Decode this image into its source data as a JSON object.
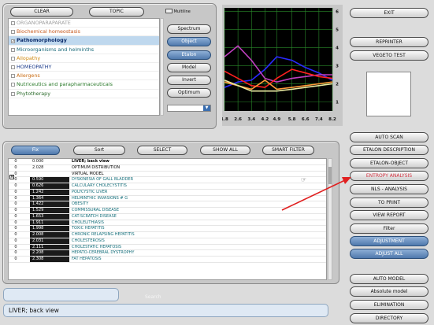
{
  "top_panel": {
    "clear_label": "CLEAR",
    "topic_label": "TOPIC",
    "multiline_label": "Multiline",
    "categories": [
      {
        "label": "ORGANOPARAPARATE",
        "color": "#a0a0a0",
        "checked": false,
        "selected": false
      },
      {
        "label": "Biochemical homeostasis",
        "color": "#c75a1e",
        "checked": false,
        "selected": false
      },
      {
        "label": "Pathomorphology",
        "color": "#0b2b6b",
        "checked": true,
        "selected": true
      },
      {
        "label": "Microorganisms and helminths",
        "color": "#1a6a7a",
        "checked": false,
        "selected": false
      },
      {
        "label": "Allopathy",
        "color": "#d08a10",
        "checked": false,
        "selected": false
      },
      {
        "label": "HOMEOPATHY",
        "color": "#1a3a8a",
        "checked": false,
        "selected": false
      },
      {
        "label": "Allergens",
        "color": "#c86a10",
        "checked": false,
        "selected": false
      },
      {
        "label": "Nutriceutics and parapharmaceuticals",
        "color": "#2a7a2a",
        "checked": false,
        "selected": false
      },
      {
        "label": "Phytotherapy",
        "color": "#2a6a2a",
        "checked": false,
        "selected": false
      }
    ],
    "mode_buttons": {
      "spectrum": "Spectrum",
      "object": "Object",
      "etalon": "Etalon",
      "model": "Model",
      "invert": "Invert",
      "optimum": "Optimum"
    }
  },
  "chart_data": {
    "type": "line",
    "x": [
      1.8,
      2.6,
      3.4,
      4.2,
      4.9,
      5.8,
      6.6,
      7.4,
      8.2
    ],
    "xtick_labels": [
      "1.8",
      "2.6",
      "3.4",
      "4.2",
      "4.9",
      "5.8",
      "6.6",
      "7.4",
      "8.2"
    ],
    "ytick_labels": [
      "1",
      "2",
      "3",
      "4",
      "5",
      "6"
    ],
    "ylim": [
      0.5,
      6.2
    ],
    "series": [
      {
        "color": "#2a2aff",
        "values": [
          1.8,
          2.1,
          2.2,
          2.8,
          3.5,
          3.3,
          2.9,
          2.6,
          2.2
        ]
      },
      {
        "color": "#c040c0",
        "values": [
          3.5,
          4.1,
          3.3,
          2.3,
          2.1,
          2.3,
          2.4,
          2.5,
          2.5
        ]
      },
      {
        "color": "#ff2020",
        "values": [
          2.7,
          2.3,
          1.9,
          1.8,
          2.3,
          2.8,
          2.6,
          2.4,
          2.3
        ]
      },
      {
        "color": "#ff9a3a",
        "values": [
          2.1,
          1.9,
          1.7,
          2.2,
          1.7,
          1.8,
          1.9,
          2.0,
          2.1
        ]
      },
      {
        "color": "#e8e8a0",
        "values": [
          2.2,
          1.9,
          1.6,
          1.6,
          1.6,
          1.7,
          1.8,
          1.9,
          2.0
        ]
      }
    ]
  },
  "right_top": {
    "exit": "EXIT",
    "reprinter": "REPRINTER",
    "vegeto_test": "VEGETO TEST"
  },
  "toolbar": {
    "fix": "Fix",
    "sort": "Sort",
    "select": "SELECT",
    "show_all": "SHOW ALL",
    "smart_filter": "SMART FILTER"
  },
  "table": {
    "rows": [
      {
        "c1": "0",
        "c2": "0.000",
        "c3": "LIVER; back view",
        "dark": false,
        "style": "hdr"
      },
      {
        "c1": "0",
        "c2": "2.028",
        "c3": "OPTIMUM DISTRIBUTION",
        "dark": false,
        "style": "plain"
      },
      {
        "c1": "0",
        "c2": "",
        "c3": "VIRTUAL MODEL",
        "dark": false,
        "style": "plain"
      },
      {
        "c1": "0",
        "c2": "0.590",
        "c3": "DYSKINESIA OF GALL BLADDER",
        "dark": true,
        "style": ""
      },
      {
        "c1": "0",
        "c2": "0.626",
        "c3": "CALCULARY CHOLECYSTITIS",
        "dark": true,
        "style": ""
      },
      {
        "c1": "0",
        "c2": "1.242",
        "c3": "POLYCYSTIC LIVER",
        "dark": true,
        "style": ""
      },
      {
        "c1": "0",
        "c2": "1.364",
        "c3": "HELMINTHIC INVASIONS  # G",
        "dark": true,
        "style": ""
      },
      {
        "c1": "0",
        "c2": "1.422",
        "c3": "OBESITY",
        "dark": true,
        "style": ""
      },
      {
        "c1": "0",
        "c2": "1.529",
        "c3": "COMMISSURAL DISEASE",
        "dark": true,
        "style": ""
      },
      {
        "c1": "0",
        "c2": "1.653",
        "c3": "CAT-SCRATCH DISEASE",
        "dark": true,
        "style": ""
      },
      {
        "c1": "0",
        "c2": "1.911",
        "c3": "CHOLELITHIASIS",
        "dark": true,
        "style": ""
      },
      {
        "c1": "0",
        "c2": "1.998",
        "c3": "TOXIC  HEPATITIS",
        "dark": true,
        "style": ""
      },
      {
        "c1": "0",
        "c2": "2.008",
        "c3": "CHRONIC  RELAPSING  HEPATITIS",
        "dark": true,
        "style": ""
      },
      {
        "c1": "0",
        "c2": "2.031",
        "c3": "CHOLESTEROSIS",
        "dark": true,
        "style": ""
      },
      {
        "c1": "0",
        "c2": "2.111",
        "c3": "CHOLESTATIC  HEPATOSIS",
        "dark": true,
        "style": ""
      },
      {
        "c1": "0",
        "c2": "2.208",
        "c3": "HEPATO-CEREBRAL  DYSTROPHY",
        "dark": true,
        "style": ""
      },
      {
        "c1": "0",
        "c2": "2.308",
        "c3": "FAT  HEPATOSIS",
        "dark": true,
        "style": ""
      }
    ]
  },
  "right_buttons": {
    "auto_scan": "AUTO SCAN",
    "etalon_description": "ETALON DESCRIPTION",
    "etalon_object": "ETALON-OBJECT",
    "entropy_analysis": "ENTROPY ANALYSIS",
    "nls_analysis": "NLS - ANALYSIS",
    "to_print": "TO PRINT",
    "view_report": "VIEW REPORT",
    "filter": "Filter",
    "adjustment": "ADJUSTMENT",
    "adjust_all": "ADJUST ALL",
    "auto_model": "AUTO MODEL",
    "absolute_model": "Absolute model",
    "elimination": "ELIMINATION",
    "directory": "DIRECTORY"
  },
  "bottom": {
    "search_placeholder": "Search",
    "status_text": "LIVER; back view"
  },
  "colors": {
    "annotation_arrow": "#e02020",
    "chart_background": "#000000",
    "chart_grid": "#2a8a2a"
  }
}
